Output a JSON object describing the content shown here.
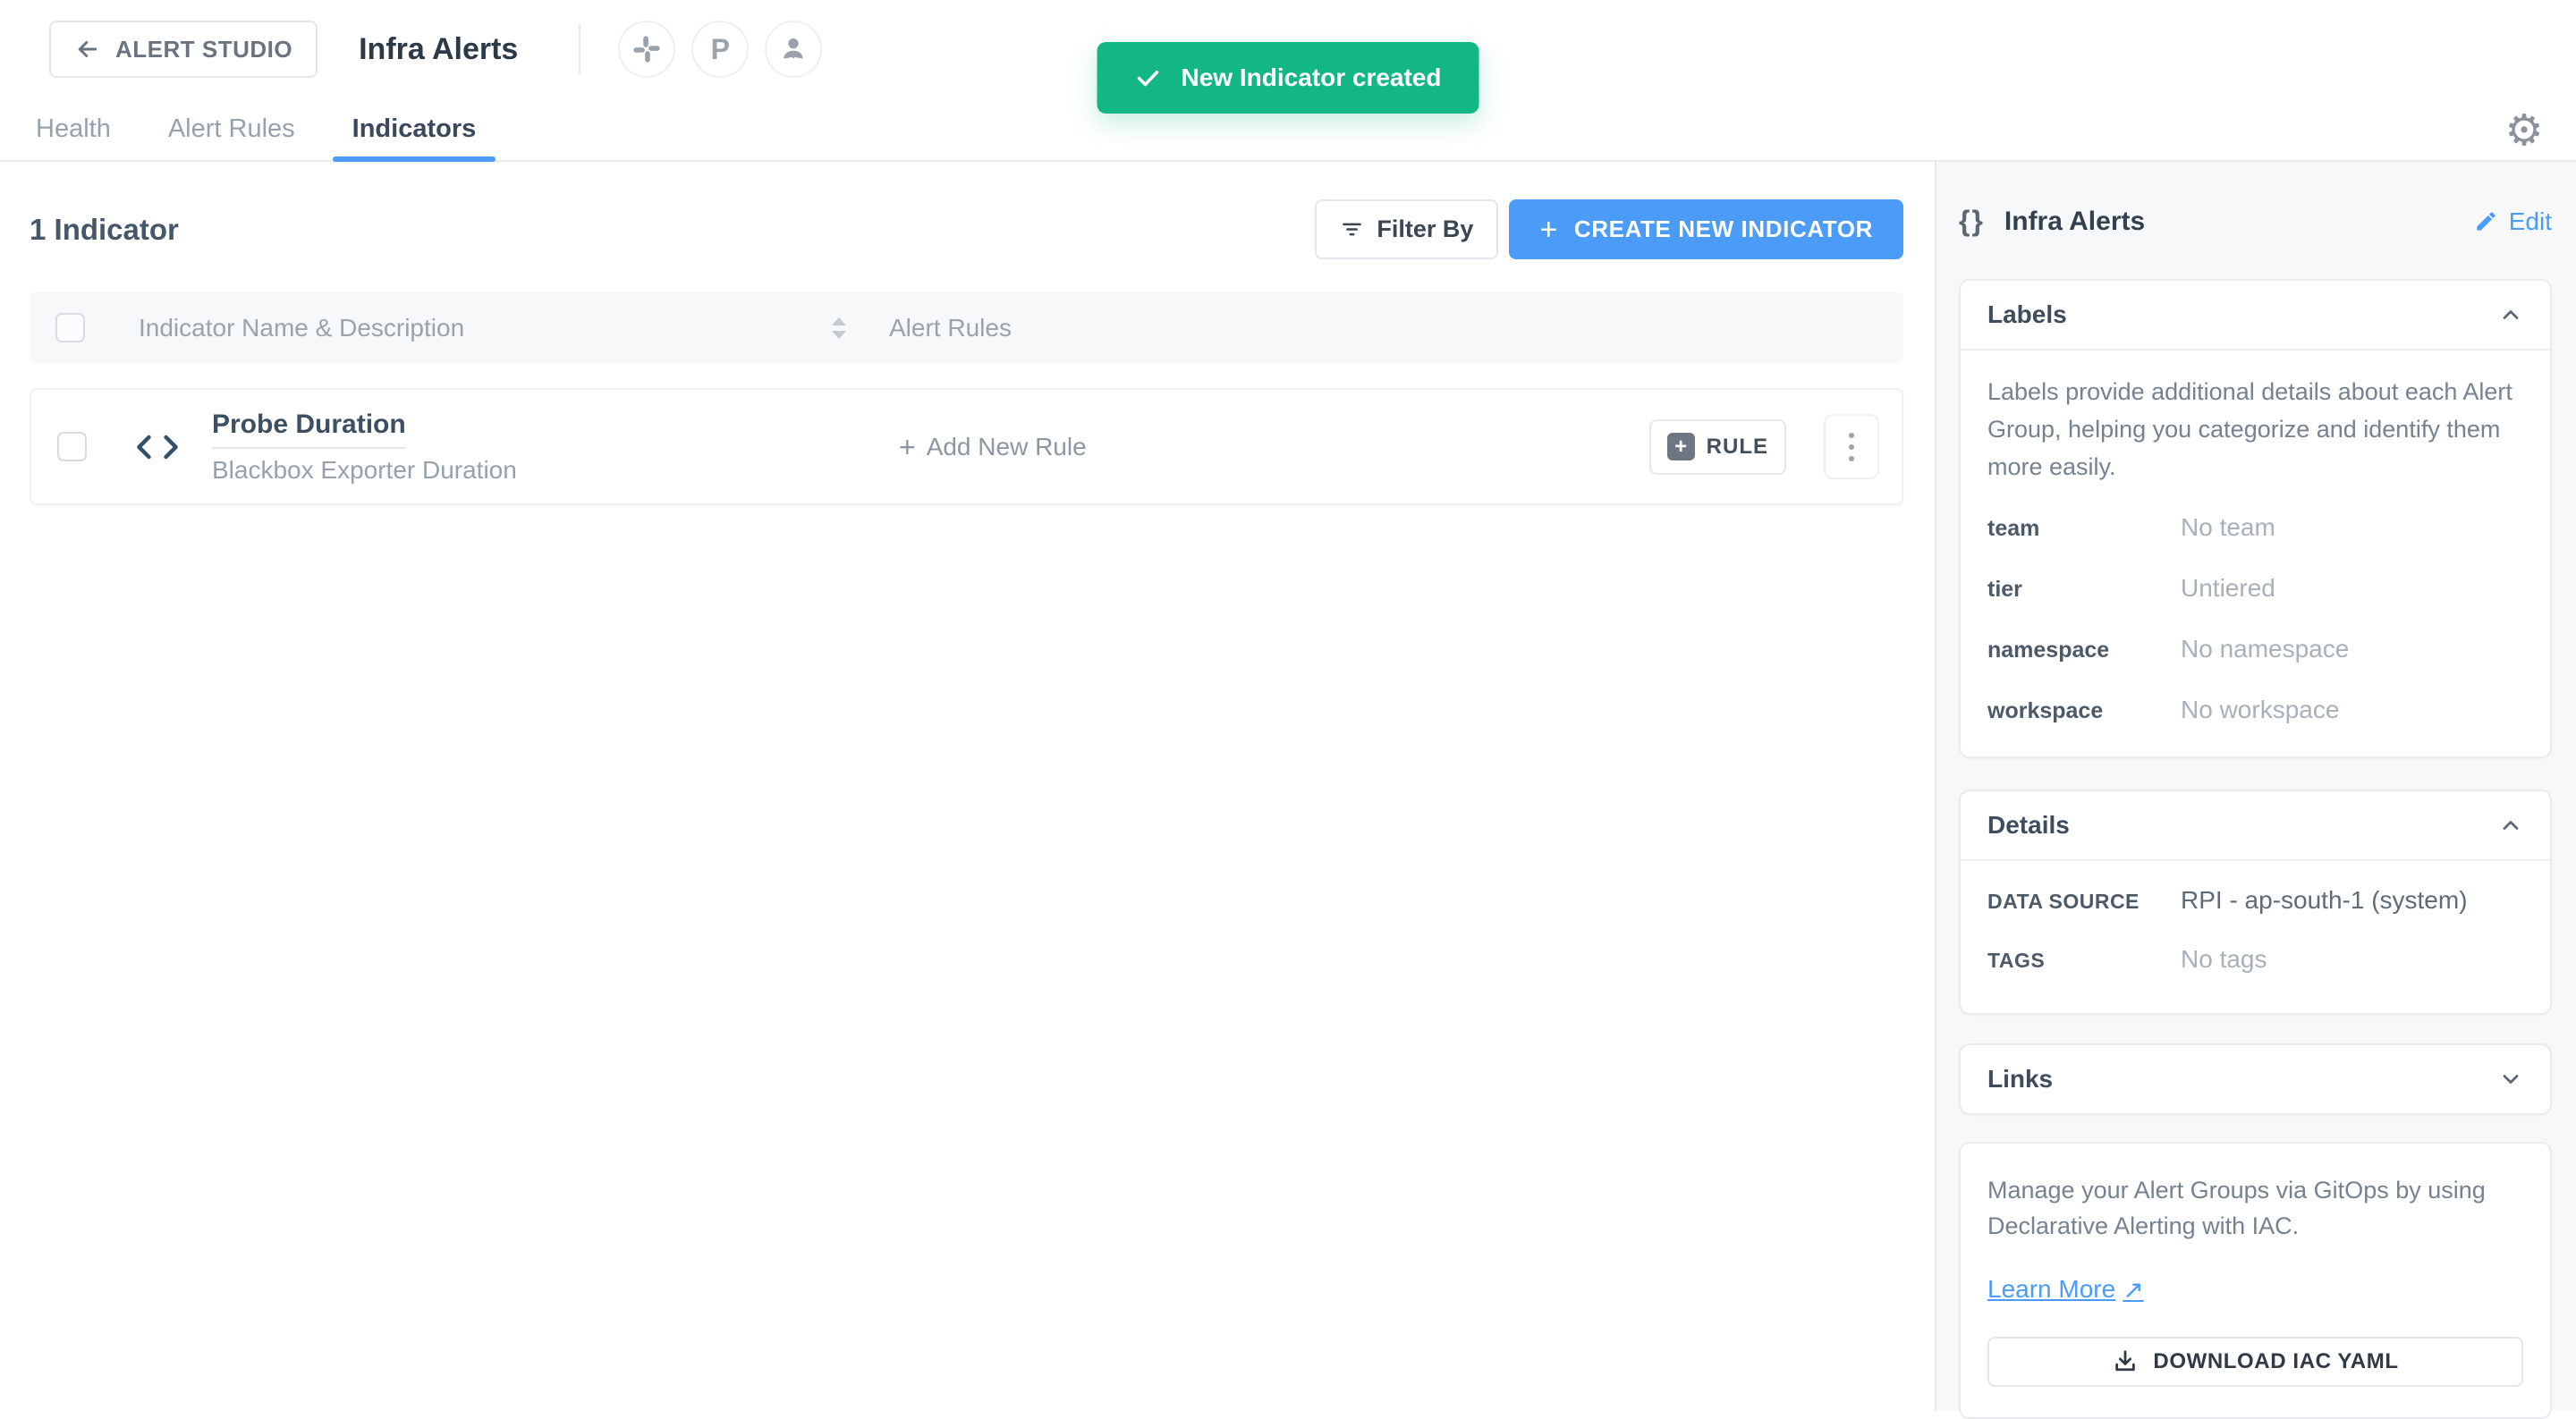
{
  "header": {
    "back_label": "ALERT STUDIO",
    "title": "Infra Alerts",
    "integrations": [
      {
        "name": "slack-icon"
      },
      {
        "name": "pagerduty-icon",
        "letter": "P"
      },
      {
        "name": "user-icon"
      }
    ],
    "tabs": [
      {
        "label": "Health"
      },
      {
        "label": "Alert Rules"
      },
      {
        "label": "Indicators"
      }
    ]
  },
  "toast": {
    "message": "New Indicator created"
  },
  "main": {
    "count_heading": "1 Indicator",
    "filter_label": "Filter By",
    "create_label": "CREATE NEW INDICATOR",
    "table": {
      "columns": {
        "name": "Indicator Name & Description",
        "rules": "Alert Rules"
      },
      "rows": [
        {
          "name": "Probe Duration",
          "description": "Blackbox Exporter Duration",
          "add_rule_label": "Add New Rule",
          "rule_button_label": "RULE"
        }
      ]
    }
  },
  "sidebar": {
    "title": "Infra Alerts",
    "edit_label": "Edit",
    "labels": {
      "title": "Labels",
      "description": "Labels provide additional details about each Alert Group, helping you categorize and identify them more easily.",
      "items": [
        {
          "key": "team",
          "value": "No team"
        },
        {
          "key": "tier",
          "value": "Untiered"
        },
        {
          "key": "namespace",
          "value": "No namespace"
        },
        {
          "key": "workspace",
          "value": "No workspace"
        }
      ]
    },
    "details": {
      "title": "Details",
      "rows": [
        {
          "key": "DATA SOURCE",
          "value": "RPI - ap-south-1 (system)"
        },
        {
          "key": "TAGS",
          "value": "No tags"
        }
      ]
    },
    "links": {
      "title": "Links"
    },
    "gitops": {
      "description": "Manage your Alert Groups via GitOps by using Declarative Alerting with IAC.",
      "learn_more_label": "Learn More",
      "download_label": "DOWNLOAD IAC YAML"
    }
  },
  "colors": {
    "accent_blue": "#4a9cf8",
    "toast_green": "#12b783",
    "text_dark": "#3d4b5c",
    "text_muted": "#9aa3ad"
  }
}
